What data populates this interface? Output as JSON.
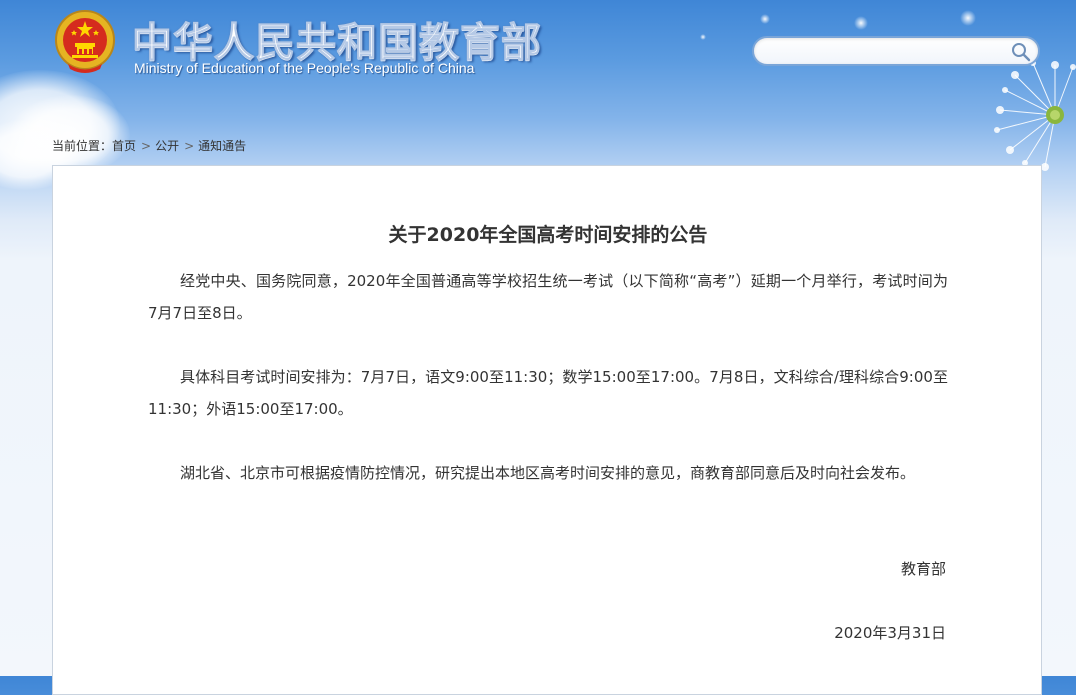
{
  "header": {
    "title_cn": "中华人民共和国教育部",
    "title_en": "Ministry of Education of the People's Republic of China",
    "emblem_icon": "national-emblem-icon",
    "search": {
      "value": "",
      "placeholder": "",
      "icon": "search-icon"
    }
  },
  "breadcrumb": {
    "label": "当前位置：",
    "items": [
      "首页",
      "公开",
      "通知通告"
    ],
    "separator_icon": "chevron-right-icon"
  },
  "article": {
    "title": "关于2020年全国高考时间安排的公告",
    "paragraphs": [
      "经党中央、国务院同意，2020年全国普通高等学校招生统一考试（以下简称“高考”）延期一个月举行，考试时间为7月7日至8日。",
      "具体科目考试时间安排为：7月7日，语文9:00至11:30；数学15:00至17:00。7月8日，文科综合/理科综合9:00至11:30；外语15:00至17:00。",
      "湖北省、北京市可根据疫情防控情况，研究提出本地区高考时间安排的意见，商教育部同意后及时向社会发布。"
    ],
    "signature": "教育部",
    "date": "2020年3月31日"
  },
  "colors": {
    "header_blue": "#3f86d6",
    "text": "#333333",
    "search_border": "#7aa5d8"
  }
}
